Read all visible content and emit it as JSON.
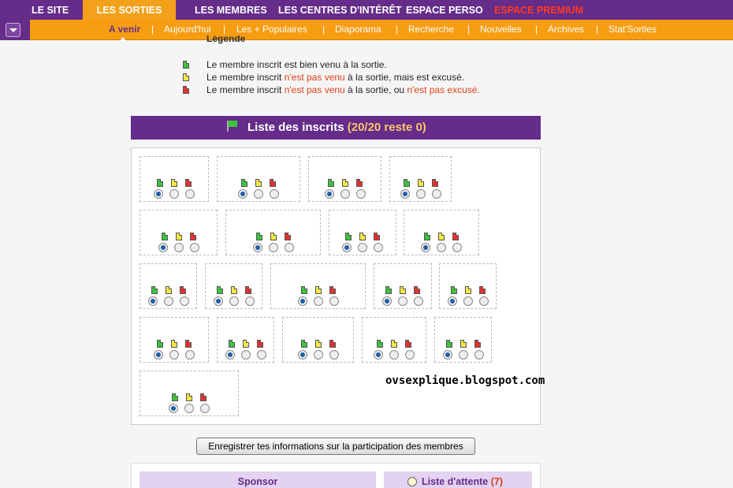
{
  "top_nav": {
    "items": [
      "LE SITE",
      "LES SORTIES",
      "LES MEMBRES",
      "LES CENTRES D'INTÉRÊT",
      "ESPACE PERSO",
      "ESPACE PREMIUM"
    ],
    "active": "LES SORTIES"
  },
  "sub_nav": {
    "items": [
      "A venir",
      "Aujourd'hui",
      "Les + Populaires",
      "Diaporama",
      "Recherche",
      "Nouvelles",
      "Archives",
      "Stat'Sorties"
    ],
    "active": "A venir",
    "separator": "|"
  },
  "legend": {
    "title": "Légende",
    "rows": [
      {
        "color": "green",
        "before": "Le membre inscrit est bien venu à la sortie.",
        "red1": "",
        "mid": "",
        "red2": ""
      },
      {
        "color": "yellow",
        "before": "Le membre inscrit ",
        "red1": "n'est pas venu",
        "mid": " à la sortie, mais est excusé.",
        "red2": ""
      },
      {
        "color": "red",
        "before": "Le membre inscrit ",
        "red1": "n'est pas venu",
        "mid": " à la sortie, ou ",
        "red2": "n'est pas excusé."
      }
    ]
  },
  "list": {
    "title": "Liste des inscrits",
    "count": "(20/20 reste 0)",
    "members_count": 20,
    "selected_option": "green"
  },
  "watermark": "ovsexplique.blogspot.com",
  "save_button": "Enregistrer tes informations sur la participation des membres",
  "sponsor": {
    "label": "Sponsor"
  },
  "waiting_list": {
    "label": "Liste d'attente",
    "count": "(7)"
  },
  "colors": {
    "purple": "#652c8a",
    "orange": "#f69d12",
    "premium_red": "#ff3b1f",
    "highlight_red": "#e0401a"
  }
}
